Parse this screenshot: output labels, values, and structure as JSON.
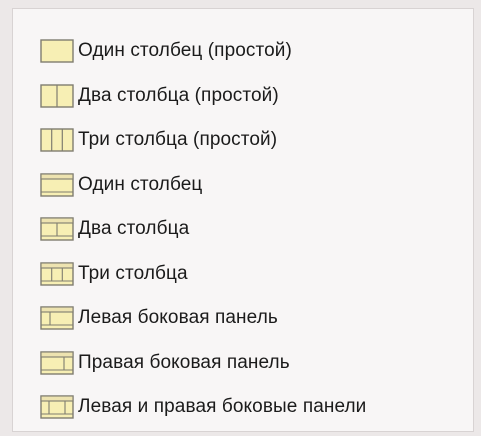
{
  "layout_options": {
    "items": [
      {
        "label": "Один столбец (простой)",
        "icon": "layout-one-column-simple-icon"
      },
      {
        "label": "Два столбца (простой)",
        "icon": "layout-two-columns-simple-icon"
      },
      {
        "label": "Три столбца (простой)",
        "icon": "layout-three-columns-simple-icon"
      },
      {
        "label": "Один столбец",
        "icon": "layout-one-column-icon"
      },
      {
        "label": "Два столбца",
        "icon": "layout-two-columns-icon"
      },
      {
        "label": "Три столбца",
        "icon": "layout-three-columns-icon"
      },
      {
        "label": "Левая боковая панель",
        "icon": "layout-left-sidebar-icon"
      },
      {
        "label": "Правая боковая панель",
        "icon": "layout-right-sidebar-icon"
      },
      {
        "label": "Левая и правая боковые панели",
        "icon": "layout-left-right-sidebars-icon"
      }
    ]
  },
  "colors": {
    "icon_fill": "#f7efb4",
    "icon_border": "#7f7d70",
    "icon_header": "#ede3b0"
  }
}
